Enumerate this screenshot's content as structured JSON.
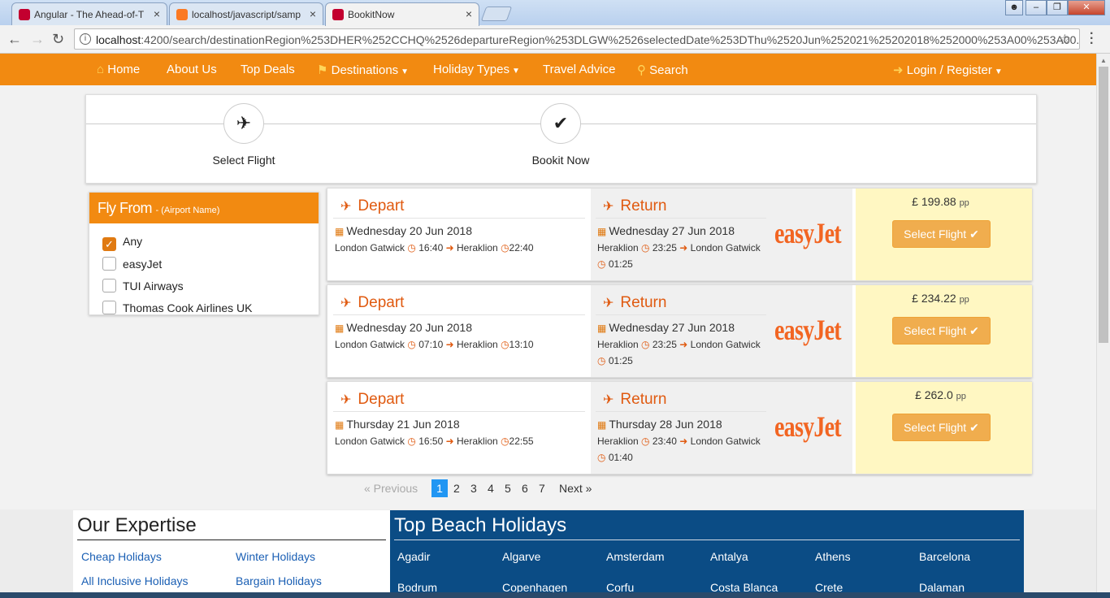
{
  "browser": {
    "tabs": [
      {
        "title": "Angular - The Ahead-of-T",
        "icon": "angular-icon"
      },
      {
        "title": "localhost/javascript/samp",
        "icon": "xampp-icon"
      },
      {
        "title": "BookitNow",
        "icon": "angular-icon"
      }
    ],
    "url_host": "localhost",
    "url_rest": ":4200/search/destinationRegion%253DHER%252CCHQ%2526departureRegion%253DLGW%2526selectedDate%253DThu%2520Jun%252021%25202018%252000%253A00%253A00..."
  },
  "nav": {
    "home": "Home",
    "about": "About Us",
    "deals": "Top Deals",
    "destinations": "Destinations",
    "holiday_types": "Holiday Types",
    "advice": "Travel Advice",
    "search": "Search",
    "login": "Login / Register"
  },
  "steps": {
    "step1": "Select Flight",
    "step2": "Bookit Now"
  },
  "filter": {
    "title": "Fly From",
    "subtitle": "- (Airport Name)",
    "options": [
      {
        "label": "Any",
        "checked": true
      },
      {
        "label": "easyJet",
        "checked": false
      },
      {
        "label": "TUI Airways",
        "checked": false
      },
      {
        "label": "Thomas Cook Airlines UK",
        "checked": false
      }
    ]
  },
  "results": [
    {
      "depart_label": "Depart",
      "depart_date": "Wednesday 20 Jun 2018",
      "depart_from": "London Gatwick",
      "depart_time": "16:40",
      "depart_to": "Heraklion",
      "depart_arrive": "22:40",
      "return_label": "Return",
      "return_date": "Wednesday 27 Jun 2018",
      "return_from": "Heraklion",
      "return_time": "23:25",
      "return_to": "London Gatwick",
      "return_arrive": "01:25",
      "airline": "easyJet",
      "price": "£ 199.88",
      "pp": "pp",
      "button": "Select Flight"
    },
    {
      "depart_label": "Depart",
      "depart_date": "Wednesday 20 Jun 2018",
      "depart_from": "London Gatwick",
      "depart_time": "07:10",
      "depart_to": "Heraklion",
      "depart_arrive": "13:10",
      "return_label": "Return",
      "return_date": "Wednesday 27 Jun 2018",
      "return_from": "Heraklion",
      "return_time": "23:25",
      "return_to": "London Gatwick",
      "return_arrive": "01:25",
      "airline": "easyJet",
      "price": "£ 234.22",
      "pp": "pp",
      "button": "Select Flight"
    },
    {
      "depart_label": "Depart",
      "depart_date": "Thursday 21 Jun 2018",
      "depart_from": "London Gatwick",
      "depart_time": "16:50",
      "depart_to": "Heraklion",
      "depart_arrive": "22:55",
      "return_label": "Return",
      "return_date": "Thursday 28 Jun 2018",
      "return_from": "Heraklion",
      "return_time": "23:40",
      "return_to": "London Gatwick",
      "return_arrive": "01:40",
      "airline": "easyJet",
      "price": "£ 262.0",
      "pp": "pp",
      "button": "Select Flight"
    }
  ],
  "pagination": {
    "previous": "« Previous",
    "pages": [
      "1",
      "2",
      "3",
      "4",
      "5",
      "6",
      "7"
    ],
    "current": "1",
    "next": "Next »"
  },
  "expertise": {
    "title": "Our Expertise",
    "links": [
      "Cheap Holidays",
      "Winter Holidays",
      "All Inclusive Holidays",
      "Bargain Holidays"
    ]
  },
  "beach": {
    "title": "Top Beach Holidays",
    "row1": [
      "Agadir",
      "Algarve",
      "Amsterdam",
      "Antalya",
      "Athens",
      "Barcelona"
    ],
    "row2": [
      "Bodrum",
      "Copenhagen",
      "Corfu",
      "Costa Blanca",
      "Crete",
      "Dalaman"
    ]
  },
  "colors": {
    "brand_orange": "#f28a11",
    "depart_accent": "#e05a10",
    "price_bg": "#fff7c2",
    "button": "#f0ad4e",
    "beach_bg": "#0b4c85",
    "page_active": "#2196f3"
  }
}
